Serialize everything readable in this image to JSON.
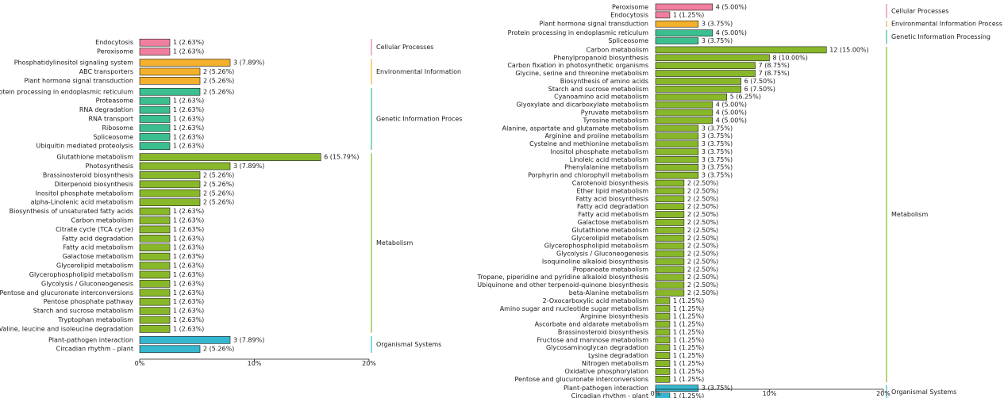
{
  "colors": {
    "Cellular Processes": "#f07f9f",
    "Environmental Information Processing": "#f3b02c",
    "Genetic Information Processing": "#3bbf8f",
    "Metabolism": "#88b82a",
    "Organismal Systems": "#35b7cf"
  },
  "chart_data": [
    {
      "type": "bar",
      "orientation": "horizontal",
      "xlim": [
        0,
        20
      ],
      "xticks": [
        "0%",
        "10%",
        "20%"
      ],
      "groups": [
        {
          "name": "Cellular Processes",
          "label": "Cellular Processes",
          "bars": [
            {
              "category": "Endocytosis",
              "count": 1,
              "percent": 2.63,
              "label": "1 (2.63%)"
            },
            {
              "category": "Peroxisome",
              "count": 1,
              "percent": 2.63,
              "label": "1 (2.63%)"
            }
          ]
        },
        {
          "name": "Environmental Information Processing",
          "label": "Environmental Information Pr",
          "bars": [
            {
              "category": "Phosphatidylinositol signaling system",
              "count": 3,
              "percent": 7.89,
              "label": "3 (7.89%)"
            },
            {
              "category": "ABC transporters",
              "count": 2,
              "percent": 5.26,
              "label": "2 (5.26%)"
            },
            {
              "category": "Plant hormone signal transduction",
              "count": 2,
              "percent": 5.26,
              "label": "2 (5.26%)"
            }
          ]
        },
        {
          "name": "Genetic Information Processing",
          "label": "Genetic Information Processir",
          "bars": [
            {
              "category": "Protein processing in endoplasmic reticulum",
              "count": 2,
              "percent": 5.26,
              "label": "2 (5.26%)"
            },
            {
              "category": "Proteasome",
              "count": 1,
              "percent": 2.63,
              "label": "1 (2.63%)"
            },
            {
              "category": "RNA degradation",
              "count": 1,
              "percent": 2.63,
              "label": "1 (2.63%)"
            },
            {
              "category": "RNA transport",
              "count": 1,
              "percent": 2.63,
              "label": "1 (2.63%)"
            },
            {
              "category": "Ribosome",
              "count": 1,
              "percent": 2.63,
              "label": "1 (2.63%)"
            },
            {
              "category": "Spliceosome",
              "count": 1,
              "percent": 2.63,
              "label": "1 (2.63%)"
            },
            {
              "category": "Ubiquitin mediated proteolysis",
              "count": 1,
              "percent": 2.63,
              "label": "1 (2.63%)"
            }
          ]
        },
        {
          "name": "Metabolism",
          "label": "Metabolism",
          "bars": [
            {
              "category": "Glutathione metabolism",
              "count": 6,
              "percent": 15.79,
              "label": "6 (15.79%)"
            },
            {
              "category": "Photosynthesis",
              "count": 3,
              "percent": 7.89,
              "label": "3 (7.89%)"
            },
            {
              "category": "Brassinosteroid biosynthesis",
              "count": 2,
              "percent": 5.26,
              "label": "2 (5.26%)"
            },
            {
              "category": "Diterpenoid biosynthesis",
              "count": 2,
              "percent": 5.26,
              "label": "2 (5.26%)"
            },
            {
              "category": "Inositol phosphate metabolism",
              "count": 2,
              "percent": 5.26,
              "label": "2 (5.26%)"
            },
            {
              "category": "alpha-Linolenic acid metabolism",
              "count": 2,
              "percent": 5.26,
              "label": "2 (5.26%)"
            },
            {
              "category": "Biosynthesis of unsaturated fatty acids",
              "count": 1,
              "percent": 2.63,
              "label": "1 (2.63%)"
            },
            {
              "category": "Carbon metabolism",
              "count": 1,
              "percent": 2.63,
              "label": "1 (2.63%)"
            },
            {
              "category": "Citrate cycle (TCA cycle)",
              "count": 1,
              "percent": 2.63,
              "label": "1 (2.63%)"
            },
            {
              "category": "Fatty acid degradation",
              "count": 1,
              "percent": 2.63,
              "label": "1 (2.63%)"
            },
            {
              "category": "Fatty acid metabolism",
              "count": 1,
              "percent": 2.63,
              "label": "1 (2.63%)"
            },
            {
              "category": "Galactose metabolism",
              "count": 1,
              "percent": 2.63,
              "label": "1 (2.63%)"
            },
            {
              "category": "Glycerolipid metabolism",
              "count": 1,
              "percent": 2.63,
              "label": "1 (2.63%)"
            },
            {
              "category": "Glycerophospholipid metabolism",
              "count": 1,
              "percent": 2.63,
              "label": "1 (2.63%)"
            },
            {
              "category": "Glycolysis / Gluconeogenesis",
              "count": 1,
              "percent": 2.63,
              "label": "1 (2.63%)"
            },
            {
              "category": "Pentose and glucuronate interconversions",
              "count": 1,
              "percent": 2.63,
              "label": "1 (2.63%)"
            },
            {
              "category": "Pentose phosphate pathway",
              "count": 1,
              "percent": 2.63,
              "label": "1 (2.63%)"
            },
            {
              "category": "Starch and sucrose metabolism",
              "count": 1,
              "percent": 2.63,
              "label": "1 (2.63%)"
            },
            {
              "category": "Tryptophan metabolism",
              "count": 1,
              "percent": 2.63,
              "label": "1 (2.63%)"
            },
            {
              "category": "Valine, leucine and isoleucine degradation",
              "count": 1,
              "percent": 2.63,
              "label": "1 (2.63%)"
            }
          ]
        },
        {
          "name": "Organismal Systems",
          "label": "Organismal Systems",
          "bars": [
            {
              "category": "Plant-pathogen interaction",
              "count": 3,
              "percent": 7.89,
              "label": "3 (7.89%)"
            },
            {
              "category": "Circadian rhythm - plant",
              "count": 2,
              "percent": 5.26,
              "label": "2 (5.26%)"
            }
          ]
        }
      ]
    },
    {
      "type": "bar",
      "orientation": "horizontal",
      "xlim": [
        0,
        20
      ],
      "xticks": [
        "0%",
        "10%",
        "20%"
      ],
      "groups": [
        {
          "name": "Cellular Processes",
          "label": "Cellular Processes",
          "bars": [
            {
              "category": "Peroxisome",
              "count": 4,
              "percent": 5.0,
              "label": "4 (5.00%)"
            },
            {
              "category": "Endocytosis",
              "count": 1,
              "percent": 1.25,
              "label": "1 (1.25%)"
            }
          ]
        },
        {
          "name": "Environmental Information Processing",
          "label": "Environmental Information Processing",
          "bars": [
            {
              "category": "Plant hormone signal transduction",
              "count": 3,
              "percent": 3.75,
              "label": "3 (3.75%)"
            }
          ]
        },
        {
          "name": "Genetic Information Processing",
          "label": "Genetic Information Processing",
          "bars": [
            {
              "category": "Protein processing in endoplasmic reticulum",
              "count": 4,
              "percent": 5.0,
              "label": "4 (5.00%)"
            },
            {
              "category": "Spliceosome",
              "count": 3,
              "percent": 3.75,
              "label": "3 (3.75%)"
            }
          ]
        },
        {
          "name": "Metabolism",
          "label": "Metabolism",
          "bars": [
            {
              "category": "Carbon metabolism",
              "count": 12,
              "percent": 15.0,
              "label": "12 (15.00%)"
            },
            {
              "category": "Phenylpropanoid biosynthesis",
              "count": 8,
              "percent": 10.0,
              "label": "8 (10.00%)"
            },
            {
              "category": "Carbon fixation in photosynthetic organisms",
              "count": 7,
              "percent": 8.75,
              "label": "7 (8.75%)"
            },
            {
              "category": "Glycine, serine and threonine metabolism",
              "count": 7,
              "percent": 8.75,
              "label": "7 (8.75%)"
            },
            {
              "category": "Biosynthesis of amino acids",
              "count": 6,
              "percent": 7.5,
              "label": "6 (7.50%)"
            },
            {
              "category": "Starch and sucrose metabolism",
              "count": 6,
              "percent": 7.5,
              "label": "6 (7.50%)"
            },
            {
              "category": "Cyanoamino acid metabolism",
              "count": 5,
              "percent": 6.25,
              "label": "5 (6.25%)"
            },
            {
              "category": "Glyoxylate and dicarboxylate metabolism",
              "count": 4,
              "percent": 5.0,
              "label": "4 (5.00%)"
            },
            {
              "category": "Pyruvate metabolism",
              "count": 4,
              "percent": 5.0,
              "label": "4 (5.00%)"
            },
            {
              "category": "Tyrosine metabolism",
              "count": 4,
              "percent": 5.0,
              "label": "4 (5.00%)"
            },
            {
              "category": "Alanine, aspartate and glutamate metabolism",
              "count": 3,
              "percent": 3.75,
              "label": "3 (3.75%)"
            },
            {
              "category": "Arginine and proline metabolism",
              "count": 3,
              "percent": 3.75,
              "label": "3 (3.75%)"
            },
            {
              "category": "Cysteine and methionine metabolism",
              "count": 3,
              "percent": 3.75,
              "label": "3 (3.75%)"
            },
            {
              "category": "Inositol phosphate metabolism",
              "count": 3,
              "percent": 3.75,
              "label": "3 (3.75%)"
            },
            {
              "category": "Linoleic acid metabolism",
              "count": 3,
              "percent": 3.75,
              "label": "3 (3.75%)"
            },
            {
              "category": "Phenylalanine metabolism",
              "count": 3,
              "percent": 3.75,
              "label": "3 (3.75%)"
            },
            {
              "category": "Porphyrin and chlorophyll metabolism",
              "count": 3,
              "percent": 3.75,
              "label": "3 (3.75%)"
            },
            {
              "category": "Carotenoid biosynthesis",
              "count": 2,
              "percent": 2.5,
              "label": "2 (2.50%)"
            },
            {
              "category": "Ether lipid metabolism",
              "count": 2,
              "percent": 2.5,
              "label": "2 (2.50%)"
            },
            {
              "category": "Fatty acid biosynthesis",
              "count": 2,
              "percent": 2.5,
              "label": "2 (2.50%)"
            },
            {
              "category": "Fatty acid degradation",
              "count": 2,
              "percent": 2.5,
              "label": "2 (2.50%)"
            },
            {
              "category": "Fatty acid metabolism",
              "count": 2,
              "percent": 2.5,
              "label": "2 (2.50%)"
            },
            {
              "category": "Galactose metabolism",
              "count": 2,
              "percent": 2.5,
              "label": "2 (2.50%)"
            },
            {
              "category": "Glutathione metabolism",
              "count": 2,
              "percent": 2.5,
              "label": "2 (2.50%)"
            },
            {
              "category": "Glycerolipid metabolism",
              "count": 2,
              "percent": 2.5,
              "label": "2 (2.50%)"
            },
            {
              "category": "Glycerophospholipid metabolism",
              "count": 2,
              "percent": 2.5,
              "label": "2 (2.50%)"
            },
            {
              "category": "Glycolysis / Gluconeogenesis",
              "count": 2,
              "percent": 2.5,
              "label": "2 (2.50%)"
            },
            {
              "category": "Isoquinoline alkaloid biosynthesis",
              "count": 2,
              "percent": 2.5,
              "label": "2 (2.50%)"
            },
            {
              "category": "Propanoate metabolism",
              "count": 2,
              "percent": 2.5,
              "label": "2 (2.50%)"
            },
            {
              "category": "Tropane, piperidine and pyridine alkaloid biosynthesis",
              "count": 2,
              "percent": 2.5,
              "label": "2 (2.50%)"
            },
            {
              "category": "Ubiquinone and other terpenoid-quinone biosynthesis",
              "count": 2,
              "percent": 2.5,
              "label": "2 (2.50%)"
            },
            {
              "category": "beta-Alanine metabolism",
              "count": 2,
              "percent": 2.5,
              "label": "2 (2.50%)"
            },
            {
              "category": "2-Oxocarboxylic acid metabolism",
              "count": 1,
              "percent": 1.25,
              "label": "1 (1.25%)"
            },
            {
              "category": "Amino sugar and nucleotide sugar metabolism",
              "count": 1,
              "percent": 1.25,
              "label": "1 (1.25%)"
            },
            {
              "category": "Arginine biosynthesis",
              "count": 1,
              "percent": 1.25,
              "label": "1 (1.25%)"
            },
            {
              "category": "Ascorbate and aldarate metabolism",
              "count": 1,
              "percent": 1.25,
              "label": "1 (1.25%)"
            },
            {
              "category": "Brassinosteroid biosynthesis",
              "count": 1,
              "percent": 1.25,
              "label": "1 (1.25%)"
            },
            {
              "category": "Fructose and mannose metabolism",
              "count": 1,
              "percent": 1.25,
              "label": "1 (1.25%)"
            },
            {
              "category": "Glycosaminoglycan degradation",
              "count": 1,
              "percent": 1.25,
              "label": "1 (1.25%)"
            },
            {
              "category": "Lysine degradation",
              "count": 1,
              "percent": 1.25,
              "label": "1 (1.25%)"
            },
            {
              "category": "Nitrogen metabolism",
              "count": 1,
              "percent": 1.25,
              "label": "1 (1.25%)"
            },
            {
              "category": "Oxidative phosphorylation",
              "count": 1,
              "percent": 1.25,
              "label": "1 (1.25%)"
            },
            {
              "category": "Pentose and glucuronate interconversions",
              "count": 1,
              "percent": 1.25,
              "label": "1 (1.25%)"
            }
          ]
        },
        {
          "name": "Organismal Systems",
          "label": "Organismal Systems",
          "bars": [
            {
              "category": "Plant-pathogen interaction",
              "count": 3,
              "percent": 3.75,
              "label": "3 (3.75%)"
            },
            {
              "category": "Circadian rhythm - plant",
              "count": 1,
              "percent": 1.25,
              "label": "1 (1.25%)"
            }
          ]
        }
      ]
    }
  ]
}
